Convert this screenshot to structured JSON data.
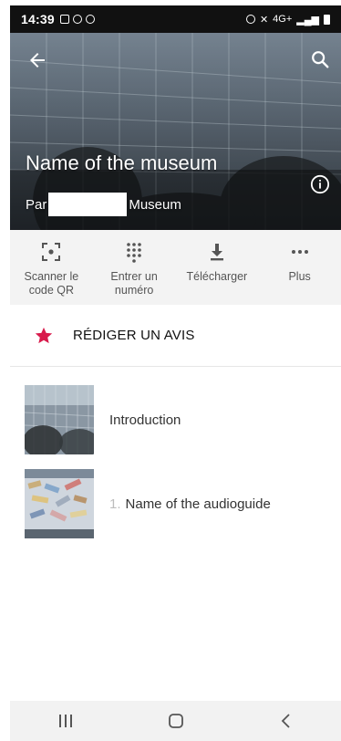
{
  "status_bar": {
    "time": "14:39",
    "network": "4G+"
  },
  "header": {
    "title": "Name of the museum",
    "by_prefix": "Par",
    "by_suffix": "Museum"
  },
  "actions": [
    {
      "label": "Scanner le\ncode QR",
      "icon": "qr-scan-icon"
    },
    {
      "label": "Entrer un\nnuméro",
      "icon": "keypad-icon"
    },
    {
      "label": "Télécharger",
      "icon": "download-icon"
    },
    {
      "label": "Plus",
      "icon": "more-icon"
    }
  ],
  "review": {
    "label": "RÉDIGER UN AVIS",
    "icon": "star-icon",
    "color": "#d81b4c"
  },
  "list": [
    {
      "number": "",
      "title": "Introduction"
    },
    {
      "number": "1.",
      "title": "Name of the audioguide"
    }
  ]
}
